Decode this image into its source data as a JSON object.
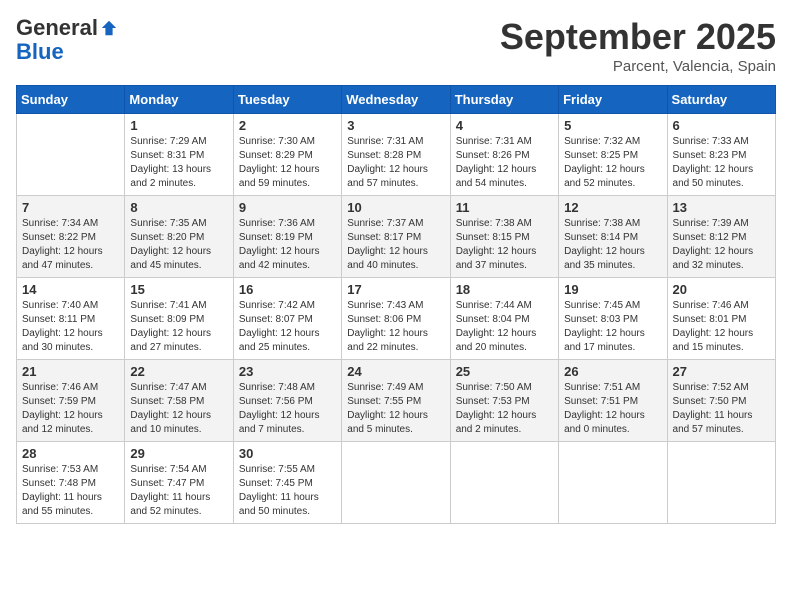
{
  "logo": {
    "general": "General",
    "blue": "Blue"
  },
  "title": "September 2025",
  "location": "Parcent, Valencia, Spain",
  "days_of_week": [
    "Sunday",
    "Monday",
    "Tuesday",
    "Wednesday",
    "Thursday",
    "Friday",
    "Saturday"
  ],
  "weeks": [
    [
      {
        "day": "",
        "info": ""
      },
      {
        "day": "1",
        "info": "Sunrise: 7:29 AM\nSunset: 8:31 PM\nDaylight: 13 hours\nand 2 minutes."
      },
      {
        "day": "2",
        "info": "Sunrise: 7:30 AM\nSunset: 8:29 PM\nDaylight: 12 hours\nand 59 minutes."
      },
      {
        "day": "3",
        "info": "Sunrise: 7:31 AM\nSunset: 8:28 PM\nDaylight: 12 hours\nand 57 minutes."
      },
      {
        "day": "4",
        "info": "Sunrise: 7:31 AM\nSunset: 8:26 PM\nDaylight: 12 hours\nand 54 minutes."
      },
      {
        "day": "5",
        "info": "Sunrise: 7:32 AM\nSunset: 8:25 PM\nDaylight: 12 hours\nand 52 minutes."
      },
      {
        "day": "6",
        "info": "Sunrise: 7:33 AM\nSunset: 8:23 PM\nDaylight: 12 hours\nand 50 minutes."
      }
    ],
    [
      {
        "day": "7",
        "info": "Sunrise: 7:34 AM\nSunset: 8:22 PM\nDaylight: 12 hours\nand 47 minutes."
      },
      {
        "day": "8",
        "info": "Sunrise: 7:35 AM\nSunset: 8:20 PM\nDaylight: 12 hours\nand 45 minutes."
      },
      {
        "day": "9",
        "info": "Sunrise: 7:36 AM\nSunset: 8:19 PM\nDaylight: 12 hours\nand 42 minutes."
      },
      {
        "day": "10",
        "info": "Sunrise: 7:37 AM\nSunset: 8:17 PM\nDaylight: 12 hours\nand 40 minutes."
      },
      {
        "day": "11",
        "info": "Sunrise: 7:38 AM\nSunset: 8:15 PM\nDaylight: 12 hours\nand 37 minutes."
      },
      {
        "day": "12",
        "info": "Sunrise: 7:38 AM\nSunset: 8:14 PM\nDaylight: 12 hours\nand 35 minutes."
      },
      {
        "day": "13",
        "info": "Sunrise: 7:39 AM\nSunset: 8:12 PM\nDaylight: 12 hours\nand 32 minutes."
      }
    ],
    [
      {
        "day": "14",
        "info": "Sunrise: 7:40 AM\nSunset: 8:11 PM\nDaylight: 12 hours\nand 30 minutes."
      },
      {
        "day": "15",
        "info": "Sunrise: 7:41 AM\nSunset: 8:09 PM\nDaylight: 12 hours\nand 27 minutes."
      },
      {
        "day": "16",
        "info": "Sunrise: 7:42 AM\nSunset: 8:07 PM\nDaylight: 12 hours\nand 25 minutes."
      },
      {
        "day": "17",
        "info": "Sunrise: 7:43 AM\nSunset: 8:06 PM\nDaylight: 12 hours\nand 22 minutes."
      },
      {
        "day": "18",
        "info": "Sunrise: 7:44 AM\nSunset: 8:04 PM\nDaylight: 12 hours\nand 20 minutes."
      },
      {
        "day": "19",
        "info": "Sunrise: 7:45 AM\nSunset: 8:03 PM\nDaylight: 12 hours\nand 17 minutes."
      },
      {
        "day": "20",
        "info": "Sunrise: 7:46 AM\nSunset: 8:01 PM\nDaylight: 12 hours\nand 15 minutes."
      }
    ],
    [
      {
        "day": "21",
        "info": "Sunrise: 7:46 AM\nSunset: 7:59 PM\nDaylight: 12 hours\nand 12 minutes."
      },
      {
        "day": "22",
        "info": "Sunrise: 7:47 AM\nSunset: 7:58 PM\nDaylight: 12 hours\nand 10 minutes."
      },
      {
        "day": "23",
        "info": "Sunrise: 7:48 AM\nSunset: 7:56 PM\nDaylight: 12 hours\nand 7 minutes."
      },
      {
        "day": "24",
        "info": "Sunrise: 7:49 AM\nSunset: 7:55 PM\nDaylight: 12 hours\nand 5 minutes."
      },
      {
        "day": "25",
        "info": "Sunrise: 7:50 AM\nSunset: 7:53 PM\nDaylight: 12 hours\nand 2 minutes."
      },
      {
        "day": "26",
        "info": "Sunrise: 7:51 AM\nSunset: 7:51 PM\nDaylight: 12 hours\nand 0 minutes."
      },
      {
        "day": "27",
        "info": "Sunrise: 7:52 AM\nSunset: 7:50 PM\nDaylight: 11 hours\nand 57 minutes."
      }
    ],
    [
      {
        "day": "28",
        "info": "Sunrise: 7:53 AM\nSunset: 7:48 PM\nDaylight: 11 hours\nand 55 minutes."
      },
      {
        "day": "29",
        "info": "Sunrise: 7:54 AM\nSunset: 7:47 PM\nDaylight: 11 hours\nand 52 minutes."
      },
      {
        "day": "30",
        "info": "Sunrise: 7:55 AM\nSunset: 7:45 PM\nDaylight: 11 hours\nand 50 minutes."
      },
      {
        "day": "",
        "info": ""
      },
      {
        "day": "",
        "info": ""
      },
      {
        "day": "",
        "info": ""
      },
      {
        "day": "",
        "info": ""
      }
    ]
  ]
}
